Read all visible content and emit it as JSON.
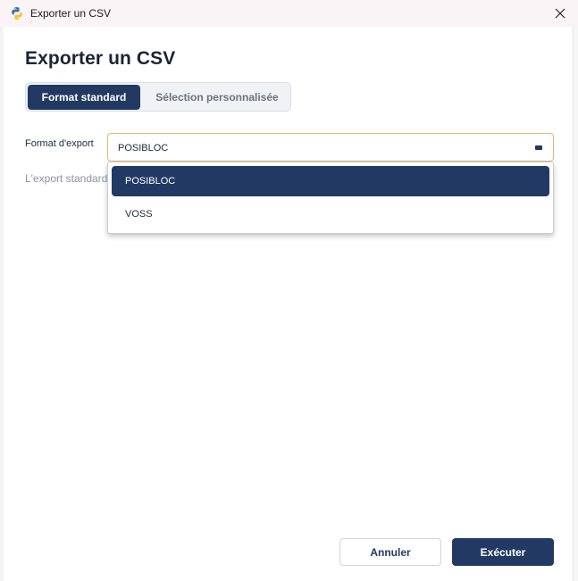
{
  "window": {
    "title": "Exporter un CSV",
    "icon": "python-icon",
    "close_icon": "close-icon"
  },
  "dialog": {
    "heading": "Exporter un CSV",
    "tabs": [
      {
        "label": "Format standard",
        "active": true
      },
      {
        "label": "Sélection personnalisée",
        "active": false
      }
    ],
    "format_label": "Format d'export",
    "format_value": "POSIBLOC",
    "hint": "L'export standard",
    "options": [
      {
        "label": "POSIBLOC",
        "selected": true
      },
      {
        "label": "VOSS",
        "selected": false
      }
    ]
  },
  "footer": {
    "cancel_label": "Annuler",
    "run_label": "Exécuter"
  },
  "colors": {
    "primary": "#223a63",
    "focus_border": "#e7b76f",
    "titlebar": "#fbf4f7",
    "muted_text": "#8a93a0"
  }
}
